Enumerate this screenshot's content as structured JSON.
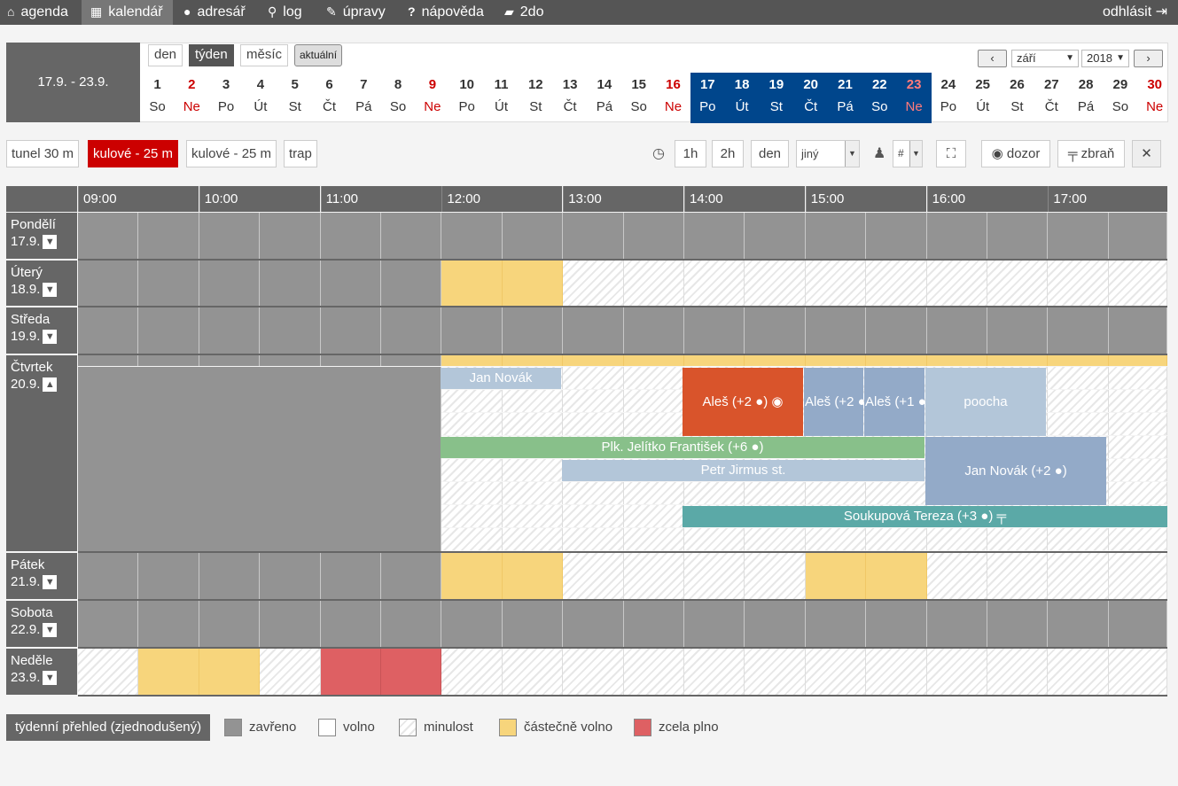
{
  "nav": {
    "agenda": "agenda",
    "kalendar": "kalendář",
    "adresar": "adresář",
    "log": "log",
    "upravy": "úpravy",
    "napoveda": "nápověda",
    "todo": "2do",
    "logout": "odhlásit"
  },
  "range_label": "17.9. - 23.9.",
  "views": {
    "day": "den",
    "week": "týden",
    "month": "měsíc",
    "current": "aktuální",
    "active": "týden"
  },
  "month_select": "září",
  "year_select": "2018",
  "days_strip": [
    {
      "n": "1",
      "d": "So"
    },
    {
      "n": "2",
      "d": "Ne",
      "red": true
    },
    {
      "n": "3",
      "d": "Po"
    },
    {
      "n": "4",
      "d": "Út"
    },
    {
      "n": "5",
      "d": "St"
    },
    {
      "n": "6",
      "d": "Čt"
    },
    {
      "n": "7",
      "d": "Pá"
    },
    {
      "n": "8",
      "d": "So"
    },
    {
      "n": "9",
      "d": "Ne",
      "red": true
    },
    {
      "n": "10",
      "d": "Po"
    },
    {
      "n": "11",
      "d": "Út"
    },
    {
      "n": "12",
      "d": "St"
    },
    {
      "n": "13",
      "d": "Čt"
    },
    {
      "n": "14",
      "d": "Pá"
    },
    {
      "n": "15",
      "d": "So"
    },
    {
      "n": "16",
      "d": "Ne",
      "red": true
    },
    {
      "n": "17",
      "d": "Po",
      "sel": true
    },
    {
      "n": "18",
      "d": "Út",
      "sel": true
    },
    {
      "n": "19",
      "d": "St",
      "sel": true
    },
    {
      "n": "20",
      "d": "Čt",
      "sel": true
    },
    {
      "n": "21",
      "d": "Pá",
      "sel": true
    },
    {
      "n": "22",
      "d": "So",
      "sel": true
    },
    {
      "n": "23",
      "d": "Ne",
      "sel": true,
      "red": true
    },
    {
      "n": "24",
      "d": "Po"
    },
    {
      "n": "25",
      "d": "Út"
    },
    {
      "n": "26",
      "d": "St"
    },
    {
      "n": "27",
      "d": "Čt"
    },
    {
      "n": "28",
      "d": "Pá"
    },
    {
      "n": "29",
      "d": "So"
    },
    {
      "n": "30",
      "d": "Ne",
      "red": true
    }
  ],
  "ranges": {
    "r1": "tunel 30 m",
    "r2": "kulové - 25 m",
    "r3": "kulové - 25 m",
    "r4": "trap",
    "active": "kulové - 25 m"
  },
  "toolbar": {
    "h1": "1h",
    "h2": "2h",
    "den": "den",
    "other": "jiný",
    "hash": "#",
    "dozor": "dozor",
    "zbran": "zbraň"
  },
  "hours": [
    "09:00",
    "10:00",
    "11:00",
    "12:00",
    "13:00",
    "14:00",
    "15:00",
    "16:00",
    "17:00"
  ],
  "days": {
    "po": {
      "name": "Pondělí",
      "date": "17.9."
    },
    "ut": {
      "name": "Úterý",
      "date": "18.9."
    },
    "st": {
      "name": "Středa",
      "date": "19.9."
    },
    "ct": {
      "name": "Čtvrtek",
      "date": "20.9."
    },
    "pa": {
      "name": "Pátek",
      "date": "21.9."
    },
    "so": {
      "name": "Sobota",
      "date": "22.9."
    },
    "ne": {
      "name": "Neděle",
      "date": "23.9."
    }
  },
  "events": {
    "e1": "Jan Novák",
    "e2": "Aleš (+2",
    "e3": "Aleš (+2",
    "e4": "Aleš (+1",
    "e5": "poocha",
    "e6": "Plk. Jelítko František (+6",
    "e7": "Petr Jirmus st.",
    "e8": "Jan Novák (+2",
    "e9": "Soukupová Tereza (+3"
  },
  "legend": {
    "title": "týdenní přehled (zjednodušený)",
    "closed": "zavřeno",
    "free": "volno",
    "past": "minulost",
    "partial": "částečně volno",
    "full": "zcela plno"
  },
  "colors": {
    "selected_week": "#00468c",
    "active_range": "#cc0000",
    "partial": "#f7d57c",
    "full": "#de6063",
    "closed": "#939393"
  }
}
